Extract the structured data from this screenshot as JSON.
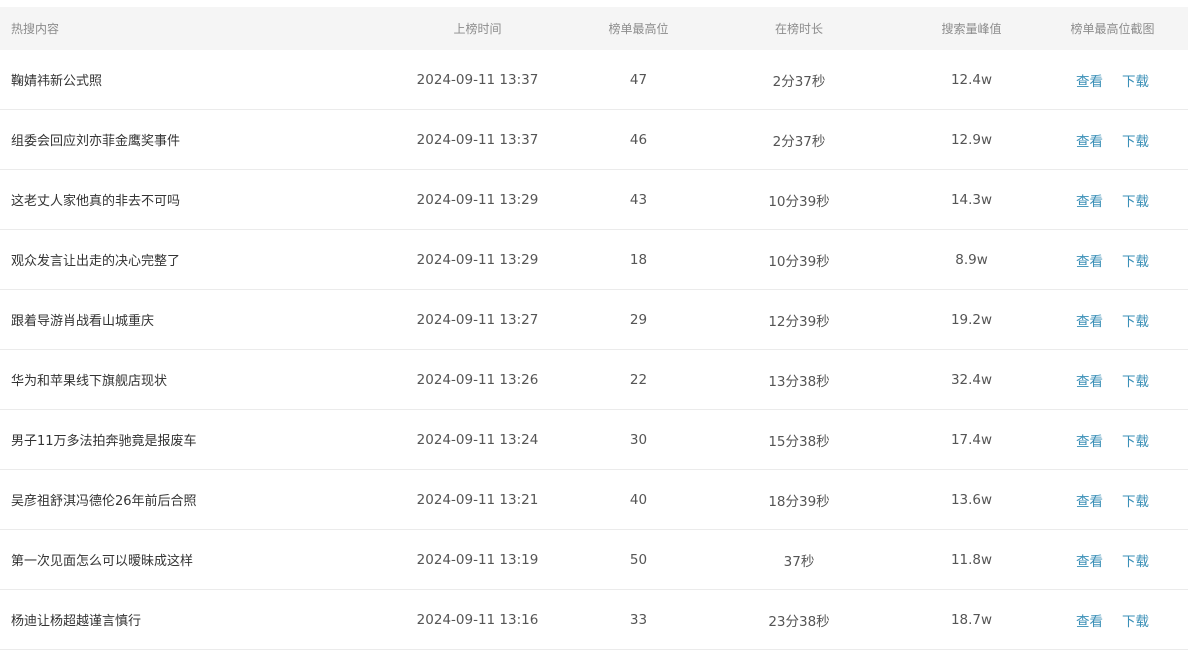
{
  "table": {
    "headers": [
      "热搜内容",
      "上榜时间",
      "榜单最高位",
      "在榜时长",
      "搜索量峰值",
      "榜单最高位截图"
    ],
    "view_label": "查看",
    "download_label": "下载",
    "rows": [
      {
        "title": "鞠婧祎新公式照",
        "time": "2024-09-11 13:37",
        "rank": "47",
        "duration": "2分37秒",
        "peak": "12.4w"
      },
      {
        "title": "组委会回应刘亦菲金鹰奖事件",
        "time": "2024-09-11 13:37",
        "rank": "46",
        "duration": "2分37秒",
        "peak": "12.9w"
      },
      {
        "title": "这老丈人家他真的非去不可吗",
        "time": "2024-09-11 13:29",
        "rank": "43",
        "duration": "10分39秒",
        "peak": "14.3w"
      },
      {
        "title": "观众发言让出走的决心完整了",
        "time": "2024-09-11 13:29",
        "rank": "18",
        "duration": "10分39秒",
        "peak": "8.9w"
      },
      {
        "title": "跟着导游肖战看山城重庆",
        "time": "2024-09-11 13:27",
        "rank": "29",
        "duration": "12分39秒",
        "peak": "19.2w"
      },
      {
        "title": "华为和苹果线下旗舰店现状",
        "time": "2024-09-11 13:26",
        "rank": "22",
        "duration": "13分38秒",
        "peak": "32.4w"
      },
      {
        "title": "男子11万多法拍奔驰竟是报废车",
        "time": "2024-09-11 13:24",
        "rank": "30",
        "duration": "15分38秒",
        "peak": "17.4w"
      },
      {
        "title": "吴彦祖舒淇冯德伦26年前后合照",
        "time": "2024-09-11 13:21",
        "rank": "40",
        "duration": "18分39秒",
        "peak": "13.6w"
      },
      {
        "title": "第一次见面怎么可以暧昧成这样",
        "time": "2024-09-11 13:19",
        "rank": "50",
        "duration": "37秒",
        "peak": "11.8w"
      },
      {
        "title": "杨迪让杨超越谨言慎行",
        "time": "2024-09-11 13:16",
        "rank": "33",
        "duration": "23分38秒",
        "peak": "18.7w"
      }
    ]
  }
}
